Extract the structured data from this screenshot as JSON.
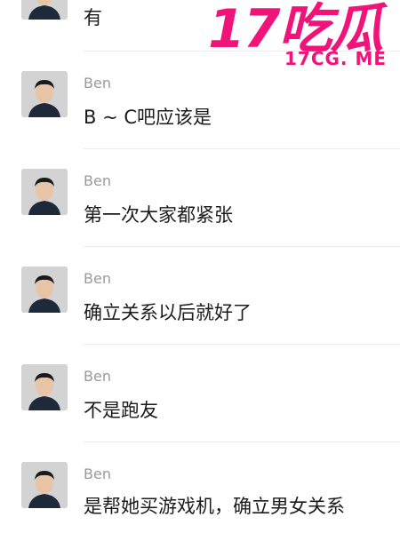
{
  "watermark": {
    "logo_text": "17吃瓜",
    "domain_text": "17CG. ME"
  },
  "colors": {
    "watermark_pink": "#f0147a",
    "sender_gray": "#9a9a9a",
    "message_text": "#1b1b1b",
    "divider": "#ececec"
  },
  "messages": [
    {
      "sender": "",
      "text": "有"
    },
    {
      "sender": "Ben",
      "text": "B ~ C吧应该是"
    },
    {
      "sender": "Ben",
      "text": "第一次大家都紧张"
    },
    {
      "sender": "Ben",
      "text": "确立关系以后就好了"
    },
    {
      "sender": "Ben",
      "text": "不是跑友"
    },
    {
      "sender": "Ben",
      "text": "是帮她买游戏机，确立男女关系"
    }
  ]
}
